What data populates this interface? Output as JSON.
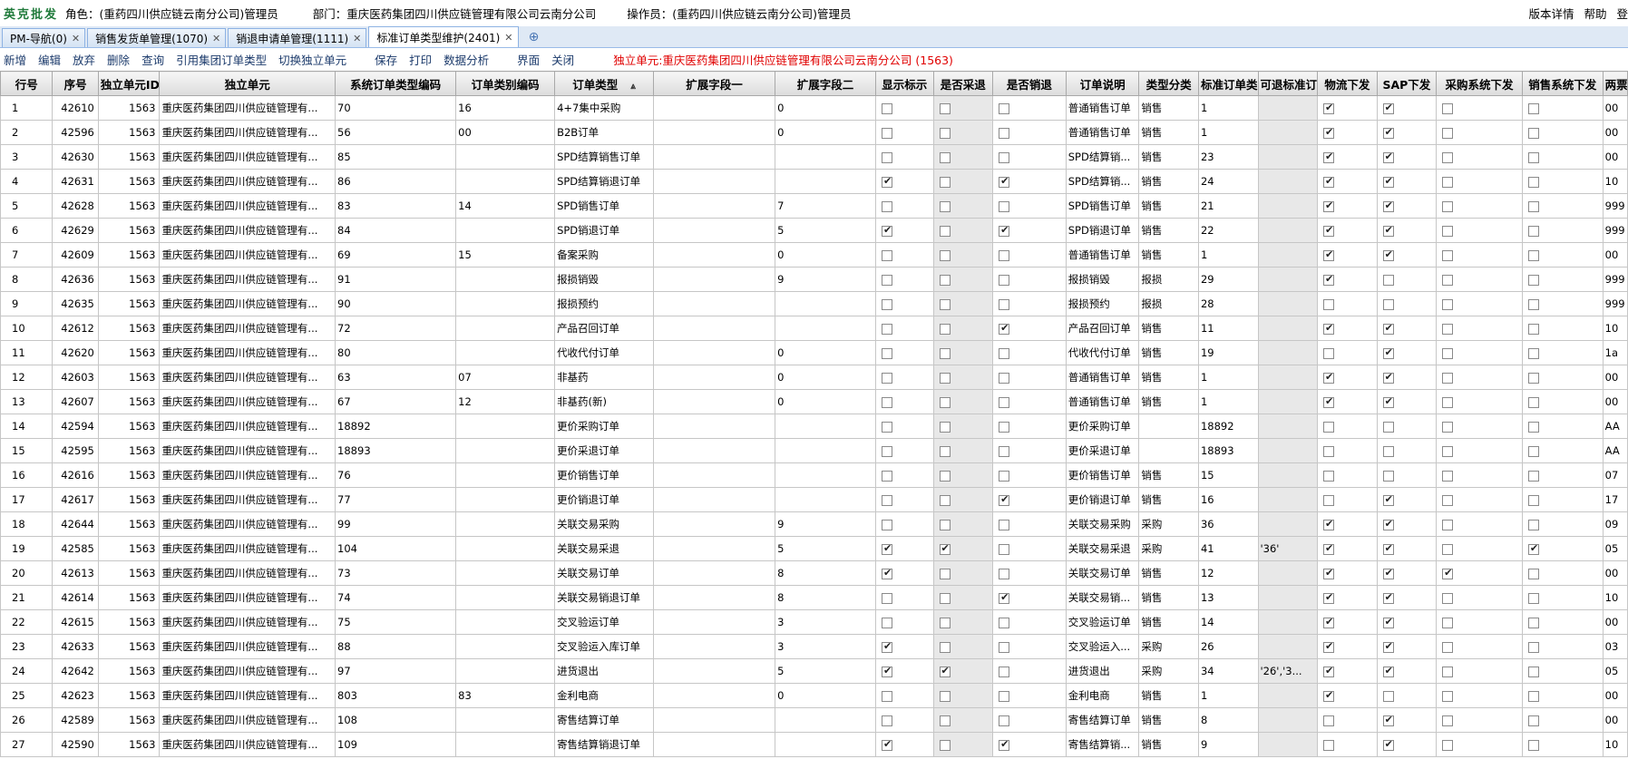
{
  "header": {
    "brand": "英克批发",
    "role": "角色：(重药四川供应链云南分公司)管理员",
    "dept": "部门：重庆医药集团四川供应链管理有限公司云南分公司",
    "operator": "操作员：(重药四川供应链云南分公司)管理员",
    "links": [
      "版本详情",
      "帮助",
      "登"
    ]
  },
  "tabs": [
    {
      "label": "PM-导航(0)",
      "closable": true,
      "active": false
    },
    {
      "label": "销售发货单管理(1070)",
      "closable": true,
      "active": false
    },
    {
      "label": "销退申请单管理(1111)",
      "closable": true,
      "active": false
    },
    {
      "label": "标准订单类型维护(2401)",
      "closable": true,
      "active": true
    }
  ],
  "toolbar": {
    "buttons": [
      "新增",
      "编辑",
      "放弃",
      "删除",
      "查询",
      "引用集团订单类型",
      "切换独立单元",
      "保存",
      "打印",
      "数据分析",
      "界面",
      "关闭"
    ],
    "note": "独立单元:重庆医药集团四川供应链管理有限公司云南分公司 (1563)"
  },
  "columns": [
    "行号",
    "序号",
    "独立单元ID",
    "独立单元",
    "系统订单类型编码",
    "订单类别编码",
    "订单类型",
    "扩展字段一",
    "扩展字段二",
    "显示标示",
    "是否采退",
    "是否销退",
    "订单说明",
    "类型分类",
    "标准订单类",
    "可退标准订",
    "物流下发",
    "SAP下发",
    "采购系统下发",
    "销售系统下发",
    "两票"
  ],
  "unit_id": "1563",
  "unit_name": "重庆医药集团四川供应链管理有...",
  "rows": [
    {
      "no": "1",
      "seq": "42610",
      "code": "70",
      "cat": "16",
      "type": "4+7集中采购",
      "ext1": "",
      "ext2": "0",
      "show": false,
      "ret_p": false,
      "ret_s": false,
      "desc": "普通销售订单",
      "cls": "销售",
      "std": "1",
      "retstd": "",
      "wl": true,
      "sap": true,
      "cg": false,
      "xs": false,
      "lp": "00"
    },
    {
      "no": "2",
      "seq": "42596",
      "code": "56",
      "cat": "00",
      "type": "B2B订单",
      "ext1": "",
      "ext2": "0",
      "show": false,
      "ret_p": false,
      "ret_s": false,
      "desc": "普通销售订单",
      "cls": "销售",
      "std": "1",
      "retstd": "",
      "wl": true,
      "sap": true,
      "cg": false,
      "xs": false,
      "lp": "00"
    },
    {
      "no": "3",
      "seq": "42630",
      "code": "85",
      "cat": "",
      "type": "SPD结算销售订单",
      "ext1": "",
      "ext2": "",
      "show": false,
      "ret_p": false,
      "ret_s": false,
      "desc": "SPD结算销...",
      "cls": "销售",
      "std": "23",
      "retstd": "",
      "wl": true,
      "sap": true,
      "cg": false,
      "xs": false,
      "lp": "00"
    },
    {
      "no": "4",
      "seq": "42631",
      "code": "86",
      "cat": "",
      "type": "SPD结算销退订单",
      "ext1": "",
      "ext2": "",
      "show": true,
      "ret_p": false,
      "ret_s": true,
      "desc": "SPD结算销...",
      "cls": "销售",
      "std": "24",
      "retstd": "",
      "wl": true,
      "sap": true,
      "cg": false,
      "xs": false,
      "lp": "10"
    },
    {
      "no": "5",
      "seq": "42628",
      "code": "83",
      "cat": "14",
      "type": "SPD销售订单",
      "ext1": "",
      "ext2": "7",
      "show": false,
      "ret_p": false,
      "ret_s": false,
      "desc": "SPD销售订单",
      "cls": "销售",
      "std": "21",
      "retstd": "",
      "wl": true,
      "sap": true,
      "cg": false,
      "xs": false,
      "lp": "999"
    },
    {
      "no": "6",
      "seq": "42629",
      "code": "84",
      "cat": "",
      "type": "SPD销退订单",
      "ext1": "",
      "ext2": "5",
      "show": true,
      "ret_p": false,
      "ret_s": true,
      "desc": "SPD销退订单",
      "cls": "销售",
      "std": "22",
      "retstd": "",
      "wl": true,
      "sap": true,
      "cg": false,
      "xs": false,
      "lp": "999"
    },
    {
      "no": "7",
      "seq": "42609",
      "code": "69",
      "cat": "15",
      "type": "备案采购",
      "ext1": "",
      "ext2": "0",
      "show": false,
      "ret_p": false,
      "ret_s": false,
      "desc": "普通销售订单",
      "cls": "销售",
      "std": "1",
      "retstd": "",
      "wl": true,
      "sap": true,
      "cg": false,
      "xs": false,
      "lp": "00"
    },
    {
      "no": "8",
      "seq": "42636",
      "code": "91",
      "cat": "",
      "type": "报损销毁",
      "ext1": "",
      "ext2": "9",
      "show": false,
      "ret_p": false,
      "ret_s": false,
      "desc": "报损销毁",
      "cls": "报损",
      "std": "29",
      "retstd": "",
      "wl": true,
      "sap": false,
      "cg": false,
      "xs": false,
      "lp": "999"
    },
    {
      "no": "9",
      "seq": "42635",
      "code": "90",
      "cat": "",
      "type": "报损预约",
      "ext1": "",
      "ext2": "",
      "show": false,
      "ret_p": false,
      "ret_s": false,
      "desc": "报损预约",
      "cls": "报损",
      "std": "28",
      "retstd": "",
      "wl": false,
      "sap": false,
      "cg": false,
      "xs": false,
      "lp": "999"
    },
    {
      "no": "10",
      "seq": "42612",
      "code": "72",
      "cat": "",
      "type": "产品召回订单",
      "ext1": "",
      "ext2": "",
      "show": false,
      "ret_p": false,
      "ret_s": true,
      "desc": "产品召回订单",
      "cls": "销售",
      "std": "11",
      "retstd": "",
      "wl": true,
      "sap": true,
      "cg": false,
      "xs": false,
      "lp": "10"
    },
    {
      "no": "11",
      "seq": "42620",
      "code": "80",
      "cat": "",
      "type": "代收代付订单",
      "ext1": "",
      "ext2": "0",
      "show": false,
      "ret_p": false,
      "ret_s": false,
      "desc": "代收代付订单",
      "cls": "销售",
      "std": "19",
      "retstd": "",
      "wl": false,
      "sap": true,
      "cg": false,
      "xs": false,
      "lp": "1a"
    },
    {
      "no": "12",
      "seq": "42603",
      "code": "63",
      "cat": "07",
      "type": "非基药",
      "ext1": "",
      "ext2": "0",
      "show": false,
      "ret_p": false,
      "ret_s": false,
      "desc": "普通销售订单",
      "cls": "销售",
      "std": "1",
      "retstd": "",
      "wl": true,
      "sap": true,
      "cg": false,
      "xs": false,
      "lp": "00"
    },
    {
      "no": "13",
      "seq": "42607",
      "code": "67",
      "cat": "12",
      "type": "非基药(新)",
      "ext1": "",
      "ext2": "0",
      "show": false,
      "ret_p": false,
      "ret_s": false,
      "desc": "普通销售订单",
      "cls": "销售",
      "std": "1",
      "retstd": "",
      "wl": true,
      "sap": true,
      "cg": false,
      "xs": false,
      "lp": "00"
    },
    {
      "no": "14",
      "seq": "42594",
      "code": "18892",
      "cat": "",
      "type": "更价采购订单",
      "ext1": "",
      "ext2": "",
      "show": false,
      "ret_p": false,
      "ret_s": false,
      "desc": "更价采购订单",
      "cls": "",
      "std": "18892",
      "retstd": "",
      "wl": false,
      "sap": false,
      "cg": false,
      "xs": false,
      "lp": "AA"
    },
    {
      "no": "15",
      "seq": "42595",
      "code": "18893",
      "cat": "",
      "type": "更价采退订单",
      "ext1": "",
      "ext2": "",
      "show": false,
      "ret_p": false,
      "ret_s": false,
      "desc": "更价采退订单",
      "cls": "",
      "std": "18893",
      "retstd": "",
      "wl": false,
      "sap": false,
      "cg": false,
      "xs": false,
      "lp": "AA"
    },
    {
      "no": "16",
      "seq": "42616",
      "code": "76",
      "cat": "",
      "type": "更价销售订单",
      "ext1": "",
      "ext2": "",
      "show": false,
      "ret_p": false,
      "ret_s": false,
      "desc": "更价销售订单",
      "cls": "销售",
      "std": "15",
      "retstd": "",
      "wl": false,
      "sap": false,
      "cg": false,
      "xs": false,
      "lp": "07"
    },
    {
      "no": "17",
      "seq": "42617",
      "code": "77",
      "cat": "",
      "type": "更价销退订单",
      "ext1": "",
      "ext2": "",
      "show": false,
      "ret_p": false,
      "ret_s": true,
      "desc": "更价销退订单",
      "cls": "销售",
      "std": "16",
      "retstd": "",
      "wl": false,
      "sap": true,
      "cg": false,
      "xs": false,
      "lp": "17"
    },
    {
      "no": "18",
      "seq": "42644",
      "code": "99",
      "cat": "",
      "type": "关联交易采购",
      "ext1": "",
      "ext2": "9",
      "show": false,
      "ret_p": false,
      "ret_s": false,
      "desc": "关联交易采购",
      "cls": "采购",
      "std": "36",
      "retstd": "",
      "wl": true,
      "sap": true,
      "cg": false,
      "xs": false,
      "lp": "09"
    },
    {
      "no": "19",
      "seq": "42585",
      "code": "104",
      "cat": "",
      "type": "关联交易采退",
      "ext1": "",
      "ext2": "5",
      "show": true,
      "ret_p": true,
      "ret_s": false,
      "desc": "关联交易采退",
      "cls": "采购",
      "std": "41",
      "retstd": "'36'",
      "wl": true,
      "sap": true,
      "cg": false,
      "xs": true,
      "lp": "05"
    },
    {
      "no": "20",
      "seq": "42613",
      "code": "73",
      "cat": "",
      "type": "关联交易订单",
      "ext1": "",
      "ext2": "8",
      "show": true,
      "ret_p": false,
      "ret_s": false,
      "desc": "关联交易订单",
      "cls": "销售",
      "std": "12",
      "retstd": "",
      "wl": true,
      "sap": true,
      "cg": true,
      "xs": false,
      "lp": "00"
    },
    {
      "no": "21",
      "seq": "42614",
      "code": "74",
      "cat": "",
      "type": "关联交易销退订单",
      "ext1": "",
      "ext2": "8",
      "show": false,
      "ret_p": false,
      "ret_s": true,
      "desc": "关联交易销...",
      "cls": "销售",
      "std": "13",
      "retstd": "",
      "wl": true,
      "sap": true,
      "cg": false,
      "xs": false,
      "lp": "10"
    },
    {
      "no": "22",
      "seq": "42615",
      "code": "75",
      "cat": "",
      "type": "交叉验运订单",
      "ext1": "",
      "ext2": "3",
      "show": false,
      "ret_p": false,
      "ret_s": false,
      "desc": "交叉验运订单",
      "cls": "销售",
      "std": "14",
      "retstd": "",
      "wl": true,
      "sap": true,
      "cg": false,
      "xs": false,
      "lp": "00"
    },
    {
      "no": "23",
      "seq": "42633",
      "code": "88",
      "cat": "",
      "type": "交叉验运入库订单",
      "ext1": "",
      "ext2": "3",
      "show": true,
      "ret_p": false,
      "ret_s": false,
      "desc": "交叉验运入...",
      "cls": "采购",
      "std": "26",
      "retstd": "",
      "wl": true,
      "sap": true,
      "cg": false,
      "xs": false,
      "lp": "03"
    },
    {
      "no": "24",
      "seq": "42642",
      "code": "97",
      "cat": "",
      "type": "进货退出",
      "ext1": "",
      "ext2": "5",
      "show": true,
      "ret_p": true,
      "ret_s": false,
      "desc": "进货退出",
      "cls": "采购",
      "std": "34",
      "retstd": "'26','3...",
      "wl": true,
      "sap": true,
      "cg": false,
      "xs": false,
      "lp": "05"
    },
    {
      "no": "25",
      "seq": "42623",
      "code": "803",
      "cat": "83",
      "type": "金利电商",
      "ext1": "",
      "ext2": "0",
      "show": false,
      "ret_p": false,
      "ret_s": false,
      "desc": "金利电商",
      "cls": "销售",
      "std": "1",
      "retstd": "",
      "wl": true,
      "sap": false,
      "cg": false,
      "xs": false,
      "lp": "00"
    },
    {
      "no": "26",
      "seq": "42589",
      "code": "108",
      "cat": "",
      "type": "寄售结算订单",
      "ext1": "",
      "ext2": "",
      "show": false,
      "ret_p": false,
      "ret_s": false,
      "desc": "寄售结算订单",
      "cls": "销售",
      "std": "8",
      "retstd": "",
      "wl": false,
      "sap": true,
      "cg": false,
      "xs": false,
      "lp": "00"
    },
    {
      "no": "27",
      "seq": "42590",
      "code": "109",
      "cat": "",
      "type": "寄售结算销退订单",
      "ext1": "",
      "ext2": "",
      "show": true,
      "ret_p": false,
      "ret_s": true,
      "desc": "寄售结算销...",
      "cls": "销售",
      "std": "9",
      "retstd": "",
      "wl": false,
      "sap": true,
      "cg": false,
      "xs": false,
      "lp": "10"
    }
  ]
}
